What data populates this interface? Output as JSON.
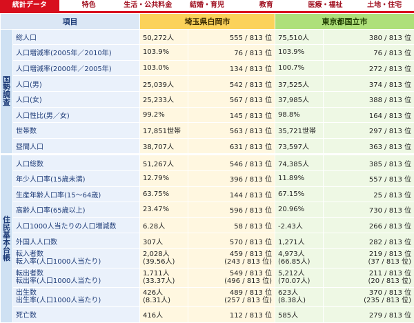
{
  "tabs": [
    "統計データ",
    "特色",
    "生活・公共料金",
    "結婚・育児",
    "教育",
    "医療・福祉",
    "土地・住宅"
  ],
  "header": {
    "item": "項目",
    "city1": "埼玉県白岡市",
    "city2": "東京都国立市"
  },
  "groups": [
    {
      "name": "国勢調査",
      "rows": [
        {
          "label": "総人口",
          "v1": "50,272人",
          "r1": "555 / 813 位",
          "v2": "75,510人",
          "r2": "380 / 813 位"
        },
        {
          "label": "人口増減率(2005年／2010年)",
          "v1": "103.9%",
          "r1": "76 / 813 位",
          "v2": "103.9%",
          "r2": "76 / 813 位"
        },
        {
          "label": "人口増減率(2000年／2005年)",
          "v1": "103.0%",
          "r1": "134 / 813 位",
          "v2": "100.7%",
          "r2": "272 / 813 位"
        },
        {
          "label": "人口(男)",
          "v1": "25,039人",
          "r1": "542 / 813 位",
          "v2": "37,525人",
          "r2": "374 / 813 位"
        },
        {
          "label": "人口(女)",
          "v1": "25,233人",
          "r1": "567 / 813 位",
          "v2": "37,985人",
          "r2": "388 / 813 位"
        },
        {
          "label": "人口性比(男／女)",
          "v1": "99.2%",
          "r1": "145 / 813 位",
          "v2": "98.8%",
          "r2": "164 / 813 位"
        },
        {
          "label": "世帯数",
          "v1": "17,851世帯",
          "r1": "563 / 813 位",
          "v2": "35,721世帯",
          "r2": "297 / 813 位"
        },
        {
          "label": "昼間人口",
          "v1": "38,707人",
          "r1": "631 / 813 位",
          "v2": "73,597人",
          "r2": "363 / 813 位"
        }
      ]
    },
    {
      "name": "住民基本台帳",
      "rows": [
        {
          "label": "人口総数",
          "v1": "51,267人",
          "r1": "546 / 813 位",
          "v2": "74,385人",
          "r2": "385 / 813 位"
        },
        {
          "label": "年少人口率(15歳未満)",
          "v1": "12.79%",
          "r1": "396 / 813 位",
          "v2": "11.89%",
          "r2": "557 / 813 位"
        },
        {
          "label": "生産年齢人口率(15〜64歳)",
          "v1": "63.75%",
          "r1": "144 / 813 位",
          "v2": "67.15%",
          "r2": "25 / 813 位"
        },
        {
          "label": "高齢人口率(65歳以上)",
          "v1": "23.47%",
          "r1": "596 / 813 位",
          "v2": "20.96%",
          "r2": "730 / 813 位"
        },
        {
          "label": "人口1000人当たりの人口増減数",
          "v1": "6.28人",
          "r1": "58 / 813 位",
          "v2": "-2.43人",
          "r2": "266 / 813 位"
        },
        {
          "label": "外国人人口数",
          "v1": "307人",
          "r1": "570 / 813 位",
          "v2": "1,271人",
          "r2": "282 / 813 位"
        },
        {
          "label": "転入者数",
          "label2": "転入率(人口1000人当たり)",
          "v1": "2,028人",
          "v1b": "(39.56人)",
          "r1": "459 / 813 位",
          "r1b": "(243 / 813 位)",
          "v2": "4,973人",
          "v2b": "(66.85人)",
          "r2": "219 / 813 位",
          "r2b": "(37 / 813 位)"
        },
        {
          "label": "転出者数",
          "label2": "転出率(人口1000人当たり)",
          "v1": "1,711人",
          "v1b": "(33.37人)",
          "r1": "549 / 813 位",
          "r1b": "(496 / 813 位)",
          "v2": "5,212人",
          "v2b": "(70.07人)",
          "r2": "211 / 813 位",
          "r2b": "(20 / 813 位)"
        },
        {
          "label": "出生数",
          "label2": "出生率(人口1000人当たり)",
          "v1": "426人",
          "v1b": "(8.31人)",
          "r1": "489 / 813 位",
          "r1b": "(257 / 813 位)",
          "v2": "623人",
          "v2b": "(8.38人)",
          "r2": "370 / 813 位",
          "r2b": "(235 / 813 位)"
        },
        {
          "label": "死亡数",
          "v1": "416人",
          "r1": "112 / 813 位",
          "v2": "585人",
          "r2": "279 / 813 位"
        }
      ]
    }
  ]
}
